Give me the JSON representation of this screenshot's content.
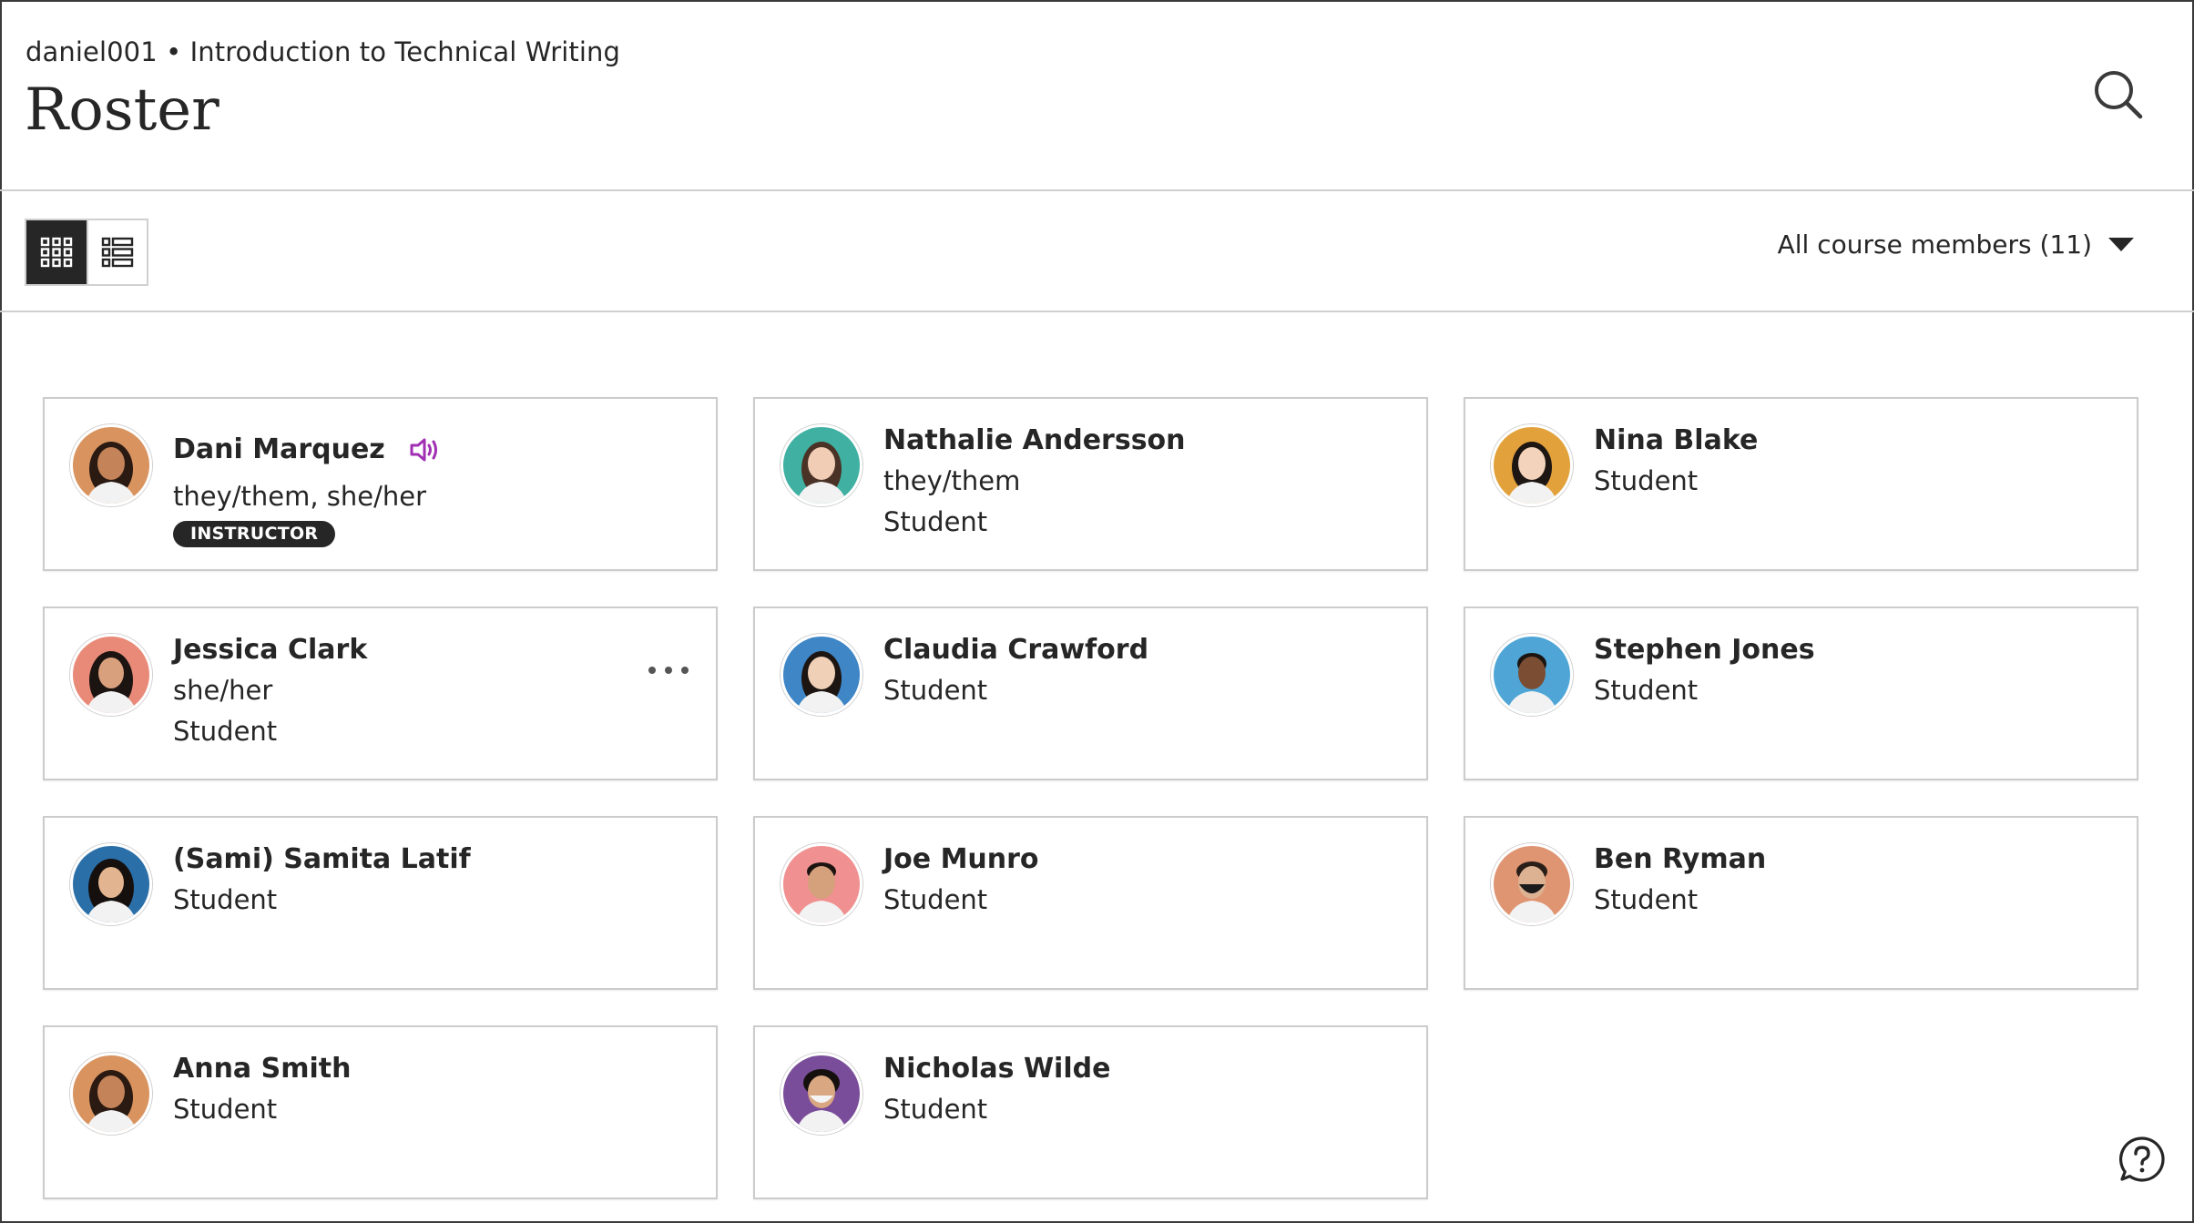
{
  "header": {
    "breadcrumb": "daniel001 • Introduction to Technical Writing",
    "title": "Roster",
    "search_icon": "search-icon"
  },
  "toolbar": {
    "views": [
      {
        "name": "grid-view",
        "icon": "grid-icon",
        "active": true
      },
      {
        "name": "list-view",
        "icon": "list-icon",
        "active": false
      }
    ],
    "filter_label": "All course members (11)"
  },
  "members": [
    {
      "name": "Dani Marquez",
      "pronouns": "they/them, she/her",
      "badge": "INSTRUCTOR",
      "has_audio": true,
      "avatar_bg": "#d9935f",
      "avatar_skin": "#c48358",
      "avatar_hair": "#2a1a12"
    },
    {
      "name": "Nathalie Andersson",
      "pronouns": "they/them",
      "role": "Student",
      "avatar_bg": "#3fb0a2",
      "avatar_skin": "#f1cdb6",
      "avatar_hair": "#4a3326"
    },
    {
      "name": "Nina Blake",
      "role": "Student",
      "avatar_bg": "#e2a13a",
      "avatar_skin": "#f3d3bb",
      "avatar_hair": "#1e1613"
    },
    {
      "name": "Jessica Clark",
      "pronouns": "she/her",
      "role": "Student",
      "has_more": true,
      "avatar_bg": "#e98a78",
      "avatar_skin": "#d9a07e",
      "avatar_hair": "#1c1411"
    },
    {
      "name": "Claudia Crawford",
      "role": "Student",
      "avatar_bg": "#3f86c6",
      "avatar_skin": "#f0d0b7",
      "avatar_hair": "#1c1512"
    },
    {
      "name": "Stephen Jones",
      "role": "Student",
      "avatar_bg": "#4fa6d6",
      "avatar_skin": "#7b4e33",
      "avatar_hair": "#1c1411"
    },
    {
      "name": "(Sami) Samita Latif",
      "role": "Student",
      "avatar_bg": "#2b6fa8",
      "avatar_skin": "#e3b490",
      "avatar_hair": "#15100e"
    },
    {
      "name": "Joe Munro",
      "role": "Student",
      "avatar_bg": "#f09090",
      "avatar_skin": "#d5a07c",
      "avatar_hair": "#1c1411"
    },
    {
      "name": "Ben Ryman",
      "role": "Student",
      "avatar_bg": "#df9472",
      "avatar_skin": "#ddb293",
      "avatar_hair": "#2a1e18"
    },
    {
      "name": "Anna Smith",
      "role": "Student",
      "avatar_bg": "#d9935f",
      "avatar_skin": "#c48358",
      "avatar_hair": "#2a1a12"
    },
    {
      "name": "Nicholas Wilde",
      "role": "Student",
      "avatar_bg": "#7a4d9a",
      "avatar_skin": "#d9a882",
      "avatar_hair": "#15100e"
    }
  ],
  "colors": {
    "accent_purple": "#a12fb3",
    "dark": "#262626",
    "border": "#cccccc"
  },
  "help_icon": "help-icon"
}
